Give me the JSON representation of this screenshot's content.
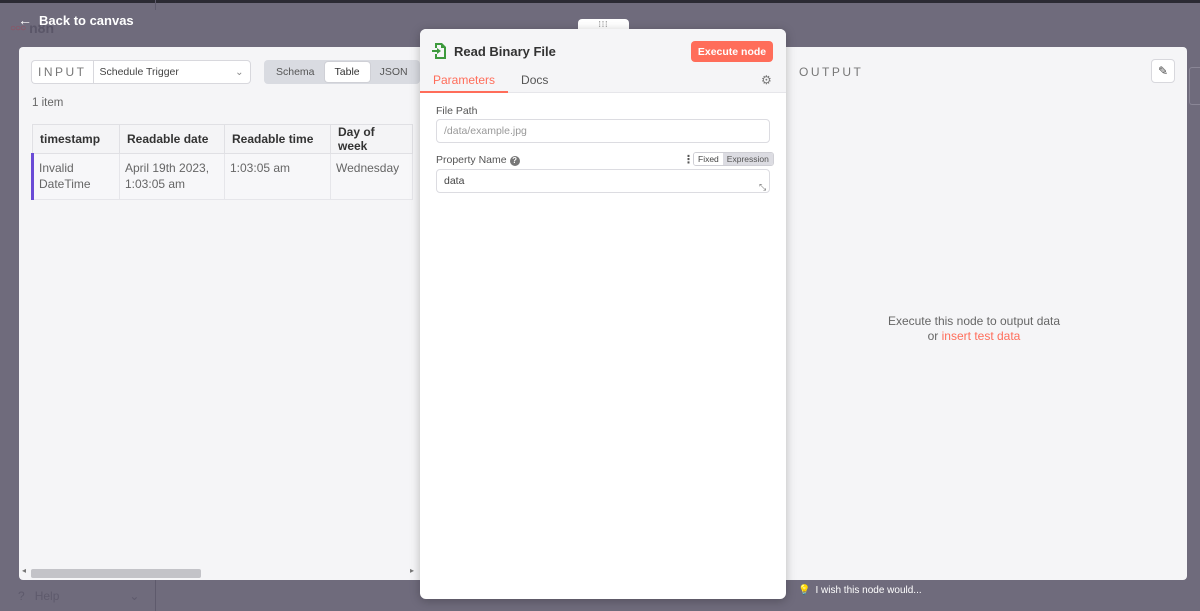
{
  "top": {
    "back_label": "Back to canvas",
    "logo_text": "n8n"
  },
  "input": {
    "title": "INPUT",
    "node_select": "Schedule Trigger",
    "modes": [
      "Schema",
      "Table",
      "JSON"
    ],
    "active_mode": "Table",
    "item_count": "1 item",
    "columns": [
      "timestamp",
      "Readable date",
      "Readable time",
      "Day of week"
    ],
    "row": {
      "timestamp": "Invalid DateTime",
      "readable_date": "April 19th 2023, 1:03:05 am",
      "readable_time": "1:03:05 am",
      "day_of_week": "Wednesday"
    }
  },
  "node": {
    "title": "Read Binary File",
    "execute_label": "Execute node",
    "tabs": [
      "Parameters",
      "Docs"
    ],
    "active_tab": "Parameters",
    "file_path_label": "File Path",
    "file_path_placeholder": "/data/example.jpg",
    "property_name_label": "Property Name",
    "property_name_value": "data",
    "toggle_fixed": "Fixed",
    "toggle_expression": "Expression"
  },
  "output": {
    "title": "OUTPUT",
    "empty_line1": "Execute this node to output data",
    "empty_or": "or",
    "empty_link": "insert test data"
  },
  "footer": {
    "wish": "I wish this node would...",
    "help": "Help"
  },
  "colors": {
    "accent": "#ff6d5a",
    "row_marker": "#6a4bd6",
    "node_icon": "#3d9a3d"
  }
}
